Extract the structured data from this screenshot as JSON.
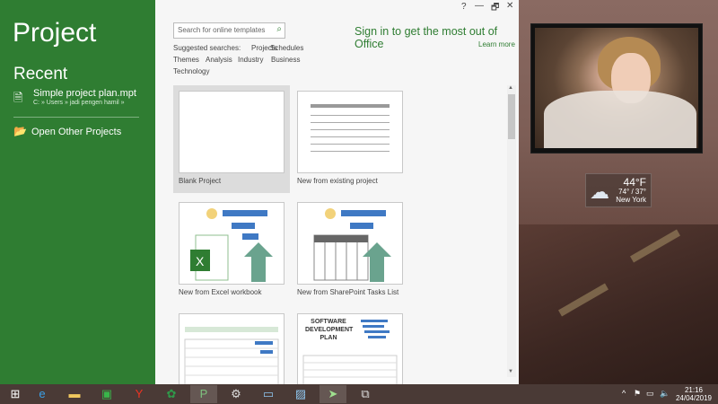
{
  "app": {
    "title": "Project"
  },
  "recent": {
    "heading": "Recent",
    "items": [
      {
        "name": "Simple project plan.mpt",
        "path": "C: » Users » jadi pengen hamil »"
      }
    ],
    "open_other": "Open Other Projects"
  },
  "window_controls": {
    "help": "?",
    "minimize": "—",
    "restore": "🗗",
    "close": "✕"
  },
  "search": {
    "placeholder": "Search for online templates"
  },
  "suggested": {
    "label": "Suggested searches:",
    "items": [
      "Projects",
      "Schedules",
      "Themes",
      "Analysis",
      "Industry",
      "Business",
      "Technology"
    ]
  },
  "account": {
    "signin": "Sign in to get the most out of Office",
    "learn_more": "Learn more"
  },
  "templates": [
    {
      "label": "Blank Project"
    },
    {
      "label": "New from existing project"
    },
    {
      "label": "New from Excel workbook"
    },
    {
      "label": "New from SharePoint Tasks List"
    },
    {
      "label": ""
    },
    {
      "label": "",
      "thumb_title": "SOFTWARE DEVELOPMENT PLAN"
    }
  ],
  "weather": {
    "temp": "44°F",
    "range": "74° / 37°",
    "city": "New York"
  },
  "taskbar": {
    "apps": [
      "windows-start",
      "internet-explorer",
      "file-explorer",
      "store",
      "yandex-browser",
      "green-app",
      "project",
      "settings",
      "photos",
      "image-viewer",
      "send",
      "remote"
    ]
  },
  "clock": {
    "time": "21:16",
    "date": "24/04/2019"
  }
}
